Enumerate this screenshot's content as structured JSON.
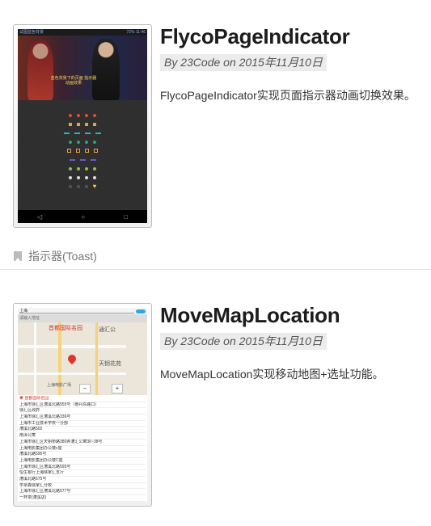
{
  "posts": [
    {
      "title": "FlycoPageIndicator",
      "meta": "By 23Code on 2015年11月10日",
      "excerpt": "FlycoPageIndicator实现页面指示器动画切换效果。",
      "screenshot": {
        "status_left": "试图蓝色背景",
        "status_right": "72% 11:46",
        "caption": "蓝色背景下的页面 指示器动画效果"
      }
    },
    {
      "title": "MoveMapLocation",
      "meta": "By 23Code on 2015年11月10日",
      "excerpt": "MoveMapLocation实现移动地图+选址功能。",
      "screenshot": {
        "search_prefix": "上海",
        "search_placeholder": "请输入地址",
        "map_labels": [
          "首都国际名园",
          "通汇公",
          "天钥花苑",
          "上海电影广场"
        ],
        "list": [
          "◉ 首都国际名园",
          "上海市徐汇区漕溪北路555号（南丹东路口）",
          "徐汇区政府",
          "上海市徐汇区漕溪北路336号",
          "上海市工业技术学校一分部",
          "漕溪北路502",
          "南泽公寓",
          "上海市徐汇区天钥桥路380弄漕汇公寓36~38号",
          "上海电影集团办公楼c座",
          "漕溪北路595号",
          "上海电影集团办公楼C座",
          "上海市徐汇区漕溪北路595号",
          "恒生银行上海徐家汇支行",
          "漕溪北路575号",
          "学京森徐家汇分校",
          "上海市徐汇区漕溪北路577号",
          "一杯茶(漕溪店)"
        ]
      }
    }
  ],
  "tag": {
    "label": "指示器(Toast)"
  },
  "icons": {
    "tag": "bookmark-icon",
    "zoom_out": "zoom-out-icon",
    "zoom_in": "zoom-in-icon",
    "map_pin": "map-pin-icon"
  }
}
